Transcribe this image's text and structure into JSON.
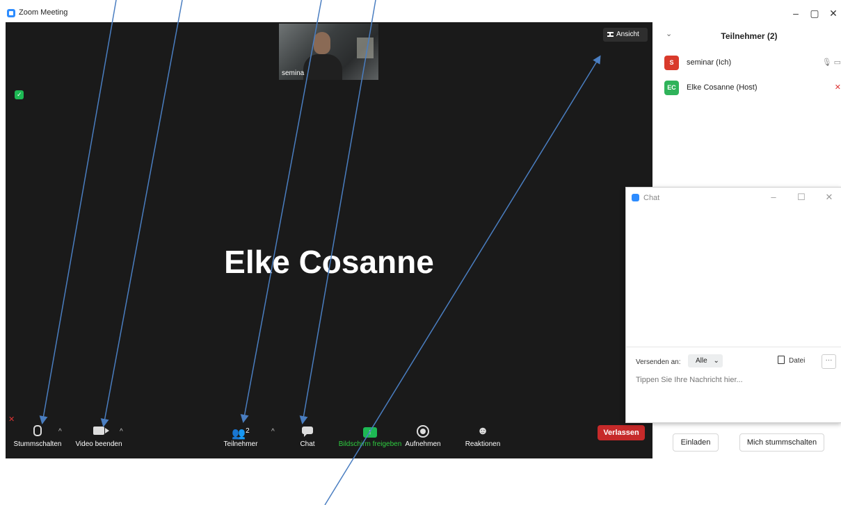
{
  "window": {
    "title": "Zoom Meeting",
    "controls": [
      "–",
      "▢",
      "✕"
    ]
  },
  "video": {
    "self_view_name": "semina",
    "view_button": "Ansicht",
    "active_speaker": "Elke Cosanne"
  },
  "toolbar": {
    "mute": "Stummschalten",
    "video": "Video beenden",
    "participants": "Teilnehmer",
    "participants_count": "2",
    "chat": "Chat",
    "share": "Bildschirm freigeben",
    "record": "Aufnehmen",
    "reactions": "Reaktionen",
    "leave": "Verlassen",
    "caret": "^"
  },
  "participants_panel": {
    "title": "Teilnehmer (2)",
    "participants": [
      {
        "initials": "S",
        "name": "seminar (Ich)",
        "avatar_color": "#d93a2b"
      },
      {
        "initials": "EC",
        "name": "Elke Cosanne (Host)",
        "avatar_color": "#2fb35a"
      }
    ],
    "invite_button": "Einladen",
    "mute_me_button": "Mich stummschalten"
  },
  "chat_window": {
    "title": "Chat",
    "send_to_label": "Versenden an:",
    "send_to_value": "Alle",
    "file_button": "Datei",
    "more_button": "···",
    "message_placeholder": "Tippen Sie Ihre Nachricht hier..."
  },
  "colors": {
    "video_bg": "#1a1a1a",
    "leave": "#c62a2a",
    "share": "#1db954",
    "annotation_arrow": "#4a7ec1",
    "brand": "#2d8cff"
  }
}
